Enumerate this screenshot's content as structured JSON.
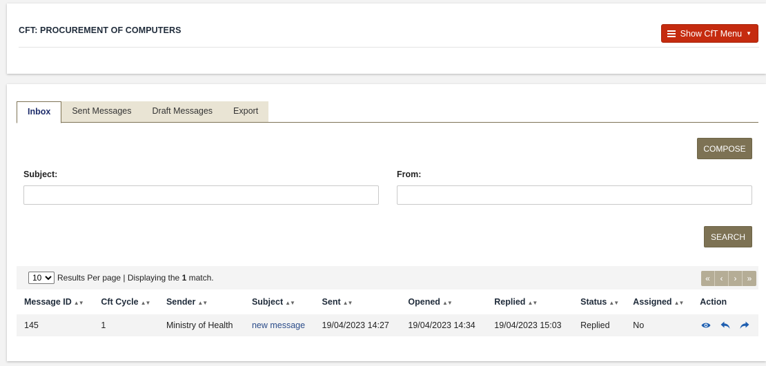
{
  "header": {
    "title": "CFT: PROCUREMENT OF COMPUTERS",
    "menu_button_label": "Show CfT Menu"
  },
  "tabs": [
    {
      "label": "Inbox",
      "active": true
    },
    {
      "label": "Sent Messages",
      "active": false
    },
    {
      "label": "Draft Messages",
      "active": false
    },
    {
      "label": "Export",
      "active": false
    }
  ],
  "compose_label": "COMPOSE",
  "search_label": "SEARCH",
  "filters": {
    "subject_label": "Subject:",
    "subject_value": "",
    "from_label": "From:",
    "from_value": ""
  },
  "results": {
    "per_page_value": "10",
    "per_page_text": "Results Per page | Displaying the",
    "match_count": "1",
    "match_suffix": "match."
  },
  "pager": [
    "«",
    "‹",
    "›",
    "»"
  ],
  "table": {
    "columns": [
      "Message ID",
      "Cft Cycle",
      "Sender",
      "Subject",
      "Sent",
      "Opened",
      "Replied",
      "Status",
      "Assigned",
      "Action"
    ],
    "rows": [
      {
        "message_id": "145",
        "cft_cycle": "1",
        "sender": "Ministry of Health",
        "subject": "new message",
        "sent": "19/04/2023 14:27",
        "opened": "19/04/2023 14:34",
        "replied": "19/04/2023 15:03",
        "status": "Replied",
        "assigned": "No",
        "actions": [
          "view-icon",
          "reply-icon",
          "forward-icon"
        ]
      }
    ]
  },
  "colors": {
    "menu_button": "#c52b0f",
    "olive_button": "#7d7254",
    "tab_inactive": "#e9e4d4",
    "pager": "#b5ad96",
    "link": "#2b4c8a",
    "action_icon": "#1f5fb0"
  }
}
